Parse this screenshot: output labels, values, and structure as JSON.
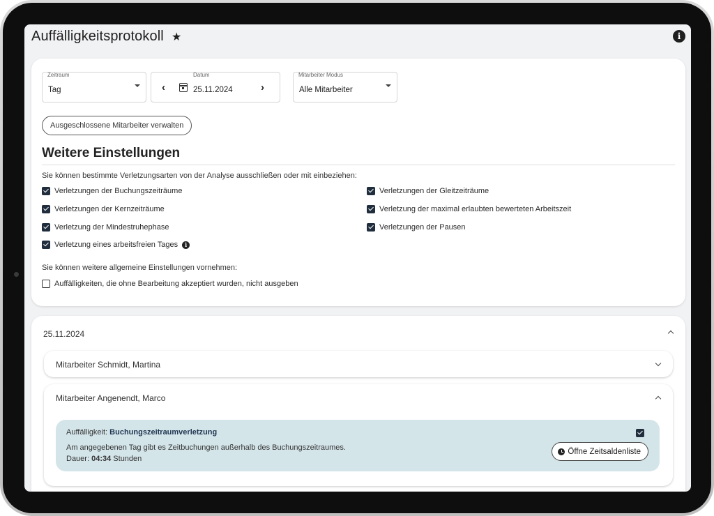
{
  "header": {
    "title": "Auffälligkeitsprotokoll",
    "star_glyph": "★",
    "info_glyph": "i"
  },
  "filters": {
    "zeitraum": {
      "label": "Zeitraum",
      "value": "Tag"
    },
    "datum": {
      "label": "Datum",
      "value": "25.11.2024"
    },
    "modus": {
      "label": "Mitarbeiter Modus",
      "value": "Alle Mitarbeiter"
    },
    "excluded_button": "Ausgeschlossene Mitarbeiter verwalten"
  },
  "settings": {
    "title": "Weitere Einstellungen",
    "violations_hint": "Sie können bestimmte Verletzungsarten von der Analyse ausschließen oder mit einbeziehen:",
    "violations": [
      {
        "label": "Verletzungen der Buchungszeiträume",
        "checked": true
      },
      {
        "label": "Verletzungen der Gleitzeiträume",
        "checked": true
      },
      {
        "label": "Verletzungen der Kernzeiträume",
        "checked": true
      },
      {
        "label": "Verletzung der maximal erlaubten bewerteten Arbeitszeit",
        "checked": true
      },
      {
        "label": "Verletzung der Mindestruhephase",
        "checked": true
      },
      {
        "label": "Verletzungen der Pausen",
        "checked": true
      },
      {
        "label": "Verletzung eines arbeitsfreien Tages",
        "checked": true
      }
    ],
    "general_hint": "Sie können weitere allgemeine Einstellungen vornehmen:",
    "general_option": {
      "label": "Auffälligkeiten, die ohne Bearbeitung akzeptiert wurden, nicht ausgeben",
      "checked": false
    }
  },
  "results": {
    "date": "25.11.2024",
    "employees": [
      {
        "name": "Mitarbeiter Schmidt, Martina",
        "expanded": false
      },
      {
        "name": "Mitarbeiter Angenendt, Marco",
        "expanded": true
      }
    ],
    "alert": {
      "prefix": "Auffälligkeit:",
      "type": "Buchungszeitraumverletzung",
      "description": "Am angegebenen Tag gibt es Zeitbuchungen außerhalb des Buchungszeitraumes.",
      "duration_prefix": "Dauer:",
      "duration_value": "04:34",
      "duration_unit": "Stunden",
      "acknowledged": true,
      "button": "Öffne Zeitsaldenliste"
    }
  },
  "colors": {
    "alert_background": "#d4e5ea",
    "checkbox": "#1f2d3d",
    "page_background": "#f1f2f4"
  }
}
